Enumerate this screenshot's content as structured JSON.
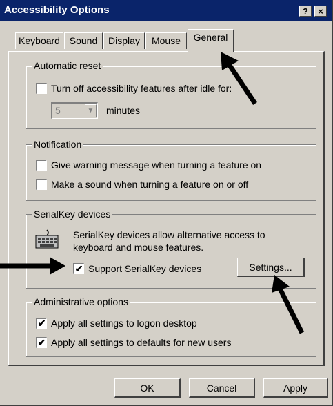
{
  "window": {
    "title": "Accessibility Options",
    "help_label": "?",
    "close_label": "×"
  },
  "tabs": [
    {
      "label": "Keyboard"
    },
    {
      "label": "Sound"
    },
    {
      "label": "Display"
    },
    {
      "label": "Mouse"
    },
    {
      "label": "General",
      "active": true
    }
  ],
  "automatic_reset": {
    "legend": "Automatic reset",
    "checkbox_label": "Turn off accessibility features after idle for:",
    "checked": false,
    "minutes_value": "5",
    "minutes_label": "minutes"
  },
  "notification": {
    "legend": "Notification",
    "items": [
      {
        "label": "Give warning message when turning a feature on",
        "checked": false
      },
      {
        "label": "Make a sound when turning a feature on or off",
        "checked": false
      }
    ]
  },
  "serialkey": {
    "legend": "SerialKey devices",
    "description": "SerialKey devices allow alternative access to keyboard and mouse features.",
    "checkbox_label": "Support SerialKey devices",
    "checked": true,
    "settings_button": "Settings..."
  },
  "administrative": {
    "legend": "Administrative options",
    "items": [
      {
        "label": "Apply all settings to logon desktop",
        "checked": true
      },
      {
        "label": "Apply all settings to defaults for new users",
        "checked": true
      }
    ]
  },
  "buttons": {
    "ok": "OK",
    "cancel": "Cancel",
    "apply": "Apply"
  },
  "check_glyph": "✔"
}
